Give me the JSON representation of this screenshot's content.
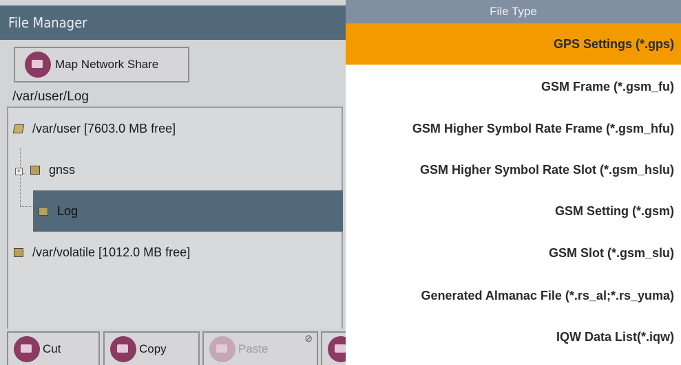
{
  "file_manager": {
    "title": "File Manager",
    "map_button_label": "Map Network Share",
    "current_path": "/var/user/Log",
    "tree": [
      {
        "label": "/var/user  [7603.0 MB free]",
        "kind": "open-folder"
      },
      {
        "label": "gnss",
        "kind": "folder",
        "expandable": true
      },
      {
        "label": "Log",
        "kind": "folder",
        "selected": true
      },
      {
        "label": "/var/volatile  [1012.0 MB free]",
        "kind": "folder"
      }
    ],
    "toolbar": {
      "cut_label": "Cut",
      "copy_label": "Copy",
      "paste_label": "Paste",
      "paste_disabled": true
    }
  },
  "file_type_list": {
    "header": "File Type",
    "items": [
      {
        "label": "GPS Settings (*.gps)",
        "selected": true
      },
      {
        "label": "GSM Frame (*.gsm_fu)"
      },
      {
        "label": "GSM Higher Symbol Rate Frame (*.gsm_hfu)"
      },
      {
        "label": "GSM Higher Symbol Rate Slot (*.gsm_hslu)"
      },
      {
        "label": "GSM Setting (*.gsm)"
      },
      {
        "label": "GSM Slot (*.gsm_slu)"
      },
      {
        "label": "Generated Almanac File (*.rs_al;*.rs_yuma)"
      },
      {
        "label": "IQW Data List(*.iqw)"
      }
    ]
  },
  "colors": {
    "selection_orange": "#f39a00",
    "selection_slate": "#52697a",
    "icon_maroon": "#8b3a62"
  }
}
